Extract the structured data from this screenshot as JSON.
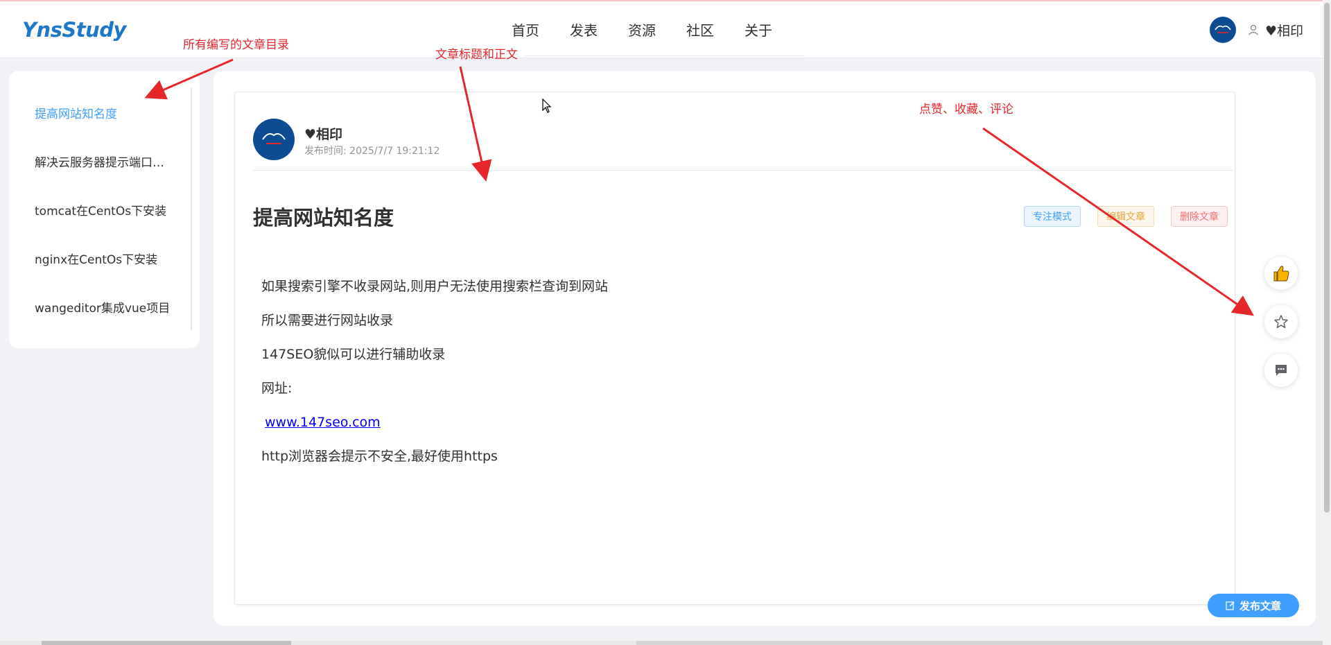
{
  "header": {
    "logo": "YnsStudy",
    "nav": [
      "首页",
      "发表",
      "资源",
      "社区",
      "关于"
    ],
    "user_name": "♥相印"
  },
  "sidebar": {
    "items": [
      {
        "label": "提高网站知名度",
        "active": true
      },
      {
        "label": "解决云服务器提示端口访问不了",
        "active": false
      },
      {
        "label": "tomcat在CentOs下安装",
        "active": false
      },
      {
        "label": "nginx在CentOs下安装",
        "active": false
      },
      {
        "label": "wangeditor集成vue项目",
        "active": false
      }
    ]
  },
  "article": {
    "author": "♥相印",
    "publish_time": "发布时间: 2025/7/7 19:21:12",
    "title": "提高网站知名度",
    "buttons": {
      "focus": "专注模式",
      "edit": "编辑文章",
      "delete": "删除文章"
    },
    "body": [
      "如果搜索引擎不收录网站,则用户无法使用搜索栏查询到网站",
      "所以需要进行网站收录",
      "147SEO貌似可以进行辅助收录",
      "网址:"
    ],
    "link": "www.147seo.com",
    "body_after": "http浏览器会提示不安全,最好使用https"
  },
  "actions": {
    "like_icon": "thumbs-up-icon",
    "collect_icon": "star-icon",
    "comment_icon": "comment-icon"
  },
  "publish_button": "发布文章",
  "annotations": {
    "sidebar_note": "所有编写的文章目录",
    "title_note": "文章标题和正文",
    "actions_note": "点赞、收藏、评论"
  },
  "colors": {
    "brand": "#1f77c8",
    "accent": "#409eff",
    "warning": "#e6a23c",
    "danger": "#f56c6c",
    "annotation": "#e5262b"
  }
}
